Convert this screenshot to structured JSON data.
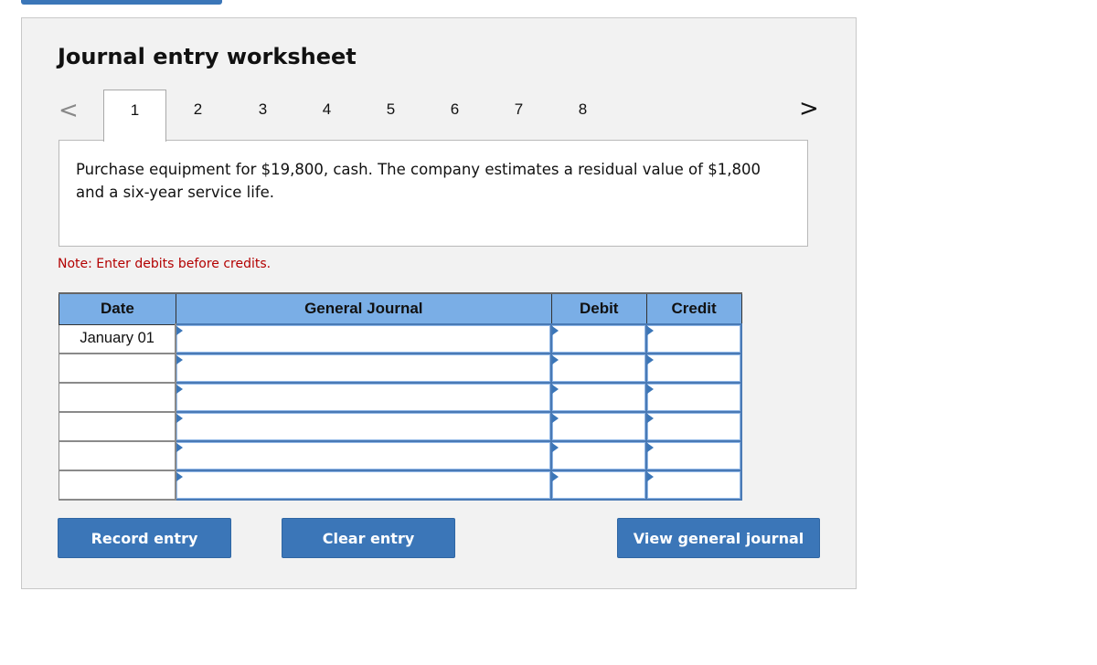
{
  "header": {
    "title": "Journal entry worksheet"
  },
  "navigation": {
    "prev_icon": "chevron-left-icon",
    "next_icon": "chevron-right-icon",
    "prev_glyph": "<",
    "next_glyph": ">",
    "tabs": [
      {
        "label": "1",
        "active": true
      },
      {
        "label": "2"
      },
      {
        "label": "3"
      },
      {
        "label": "4"
      },
      {
        "label": "5"
      },
      {
        "label": "6"
      },
      {
        "label": "7"
      },
      {
        "label": "8"
      }
    ]
  },
  "question": {
    "text": "Purchase equipment for $19,800, cash. The company estimates a residual value of $1,800 and a six-year service life."
  },
  "note": "Note: Enter debits before credits.",
  "journal": {
    "columns": [
      "Date",
      "General Journal",
      "Debit",
      "Credit"
    ],
    "rows": [
      {
        "date": "January 01",
        "account": "",
        "debit": "",
        "credit": ""
      },
      {
        "date": "",
        "account": "",
        "debit": "",
        "credit": ""
      },
      {
        "date": "",
        "account": "",
        "debit": "",
        "credit": ""
      },
      {
        "date": "",
        "account": "",
        "debit": "",
        "credit": ""
      },
      {
        "date": "",
        "account": "",
        "debit": "",
        "credit": ""
      },
      {
        "date": "",
        "account": "",
        "debit": "",
        "credit": ""
      }
    ]
  },
  "buttons": {
    "record": "Record entry",
    "clear": "Clear entry",
    "view": "View general journal"
  },
  "colors": {
    "accent": "#3b76b8",
    "header_bg": "#7aaee6",
    "note": "#b30000",
    "panel_bg": "#f2f2f2"
  }
}
